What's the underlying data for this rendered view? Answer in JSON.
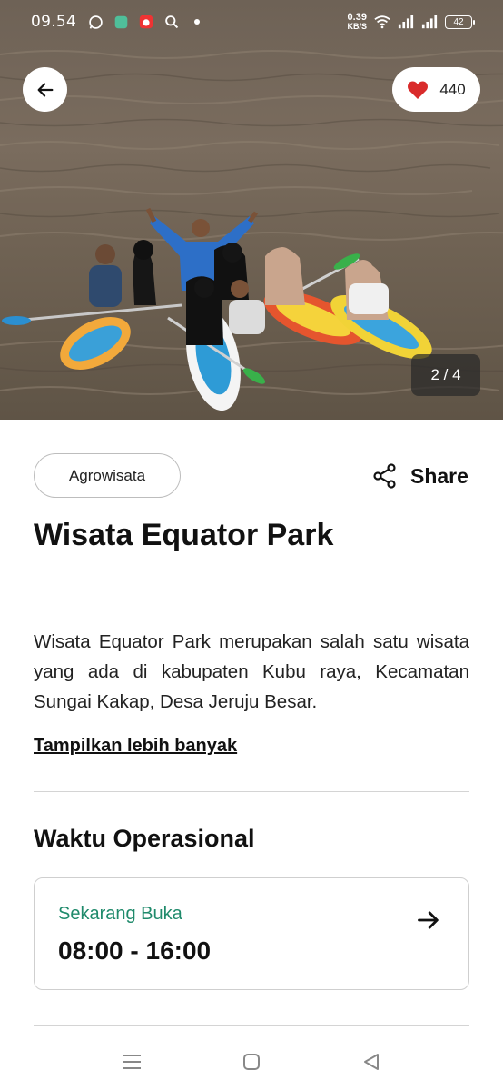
{
  "status_bar": {
    "time": "09.54",
    "net_speed_value": "0.39",
    "net_speed_unit": "KB/S",
    "battery": "42"
  },
  "hero": {
    "like_count": "440",
    "page_indicator": "2 / 4"
  },
  "place": {
    "category": "Agrowisata",
    "share_label": "Share",
    "title": "Wisata Equator Park",
    "description": "Wisata Equator Park  merupakan salah satu wisata yang ada di kabupaten Kubu raya, Kecamatan Sungai Kakap, Desa Jeruju Besar.",
    "show_more": "Tampilkan lebih banyak"
  },
  "operational": {
    "section_title": "Waktu Operasional",
    "status": "Sekarang Buka",
    "hours": "08:00 - 16:00"
  },
  "colors": {
    "accent_green": "#1f8a6b",
    "heart_red": "#d92b2b"
  },
  "icons": {
    "back": "arrow-left-icon",
    "like": "heart-icon",
    "share": "share-icon",
    "card_arrow": "arrow-right-icon",
    "nav": [
      "menu-icon",
      "home-square-icon",
      "back-triangle-icon"
    ]
  }
}
